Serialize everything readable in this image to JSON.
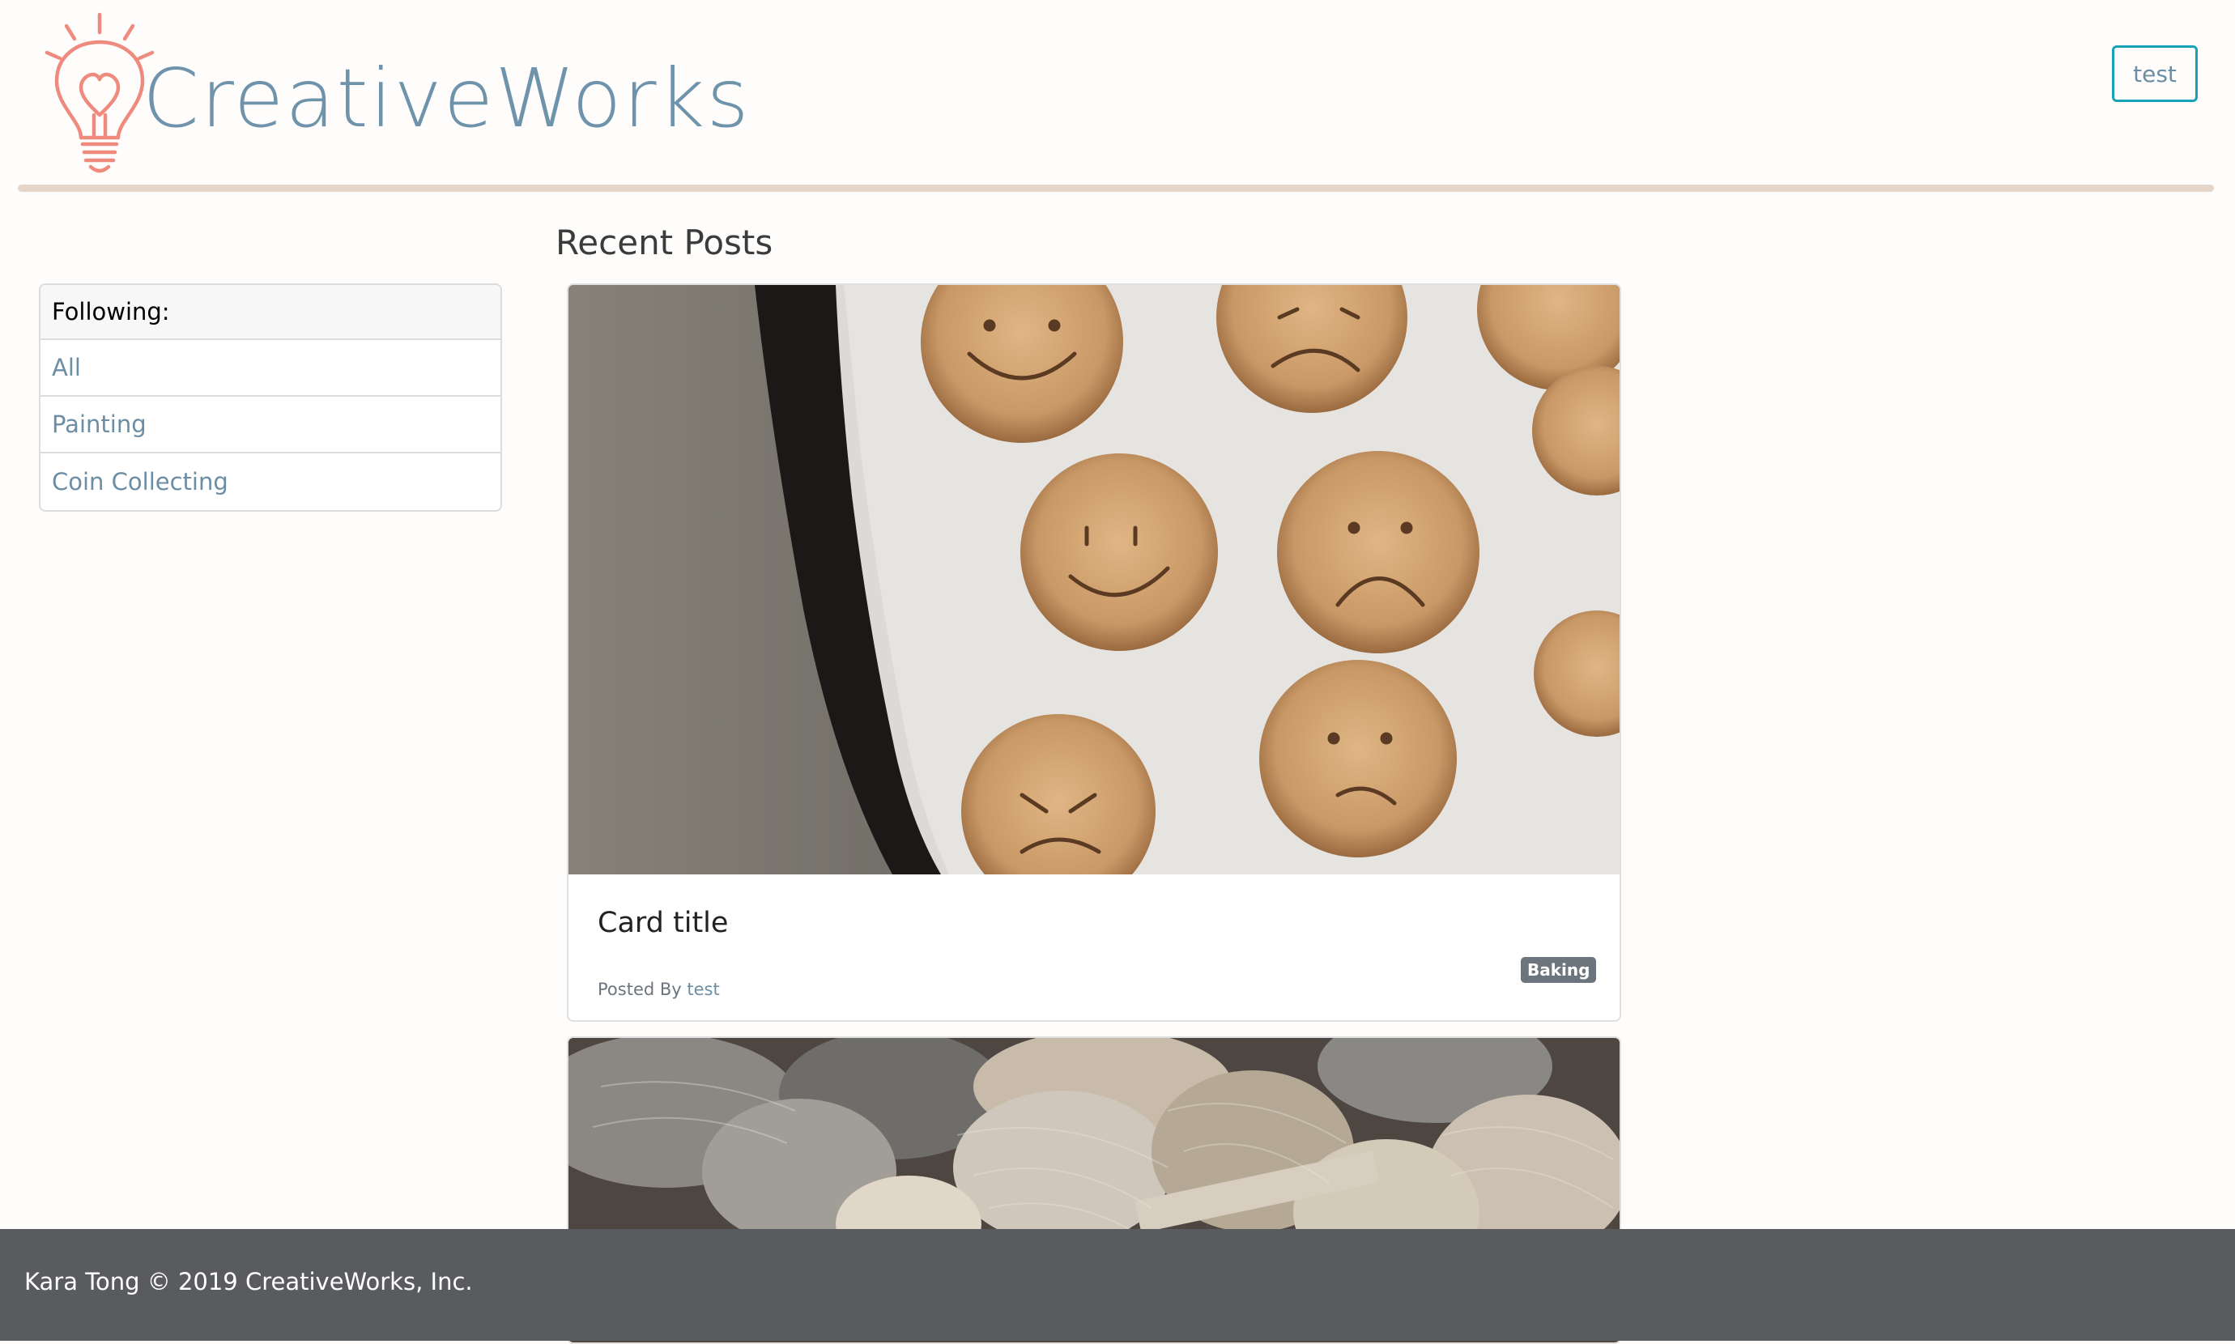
{
  "brand": {
    "name": "CreativeWorks",
    "text_color": "#6e93ab",
    "icon_color": "#ef8a7f",
    "icon": "lightbulb-heart-icon"
  },
  "header": {
    "user_button_label": "test",
    "rule_color": "#e6d6c9"
  },
  "sidebar": {
    "title": "Following:",
    "items": [
      {
        "label": "All"
      },
      {
        "label": "Painting"
      },
      {
        "label": "Coin Collecting"
      }
    ]
  },
  "main": {
    "title": "Recent Posts",
    "posts": [
      {
        "title": "Card title",
        "posted_by_label": "Posted By",
        "author": "test",
        "tag": "Baking",
        "image": "cookies-with-faces-image"
      },
      {
        "image": "yarn-balls-image"
      }
    ]
  },
  "footer": {
    "text": "Kara Tong © 2019 CreativeWorks, Inc.",
    "background": "#5a5b5e"
  },
  "colors": {
    "link": "#6b8ea4",
    "button_border": "#17a2b8",
    "badge": "#6c757d"
  }
}
